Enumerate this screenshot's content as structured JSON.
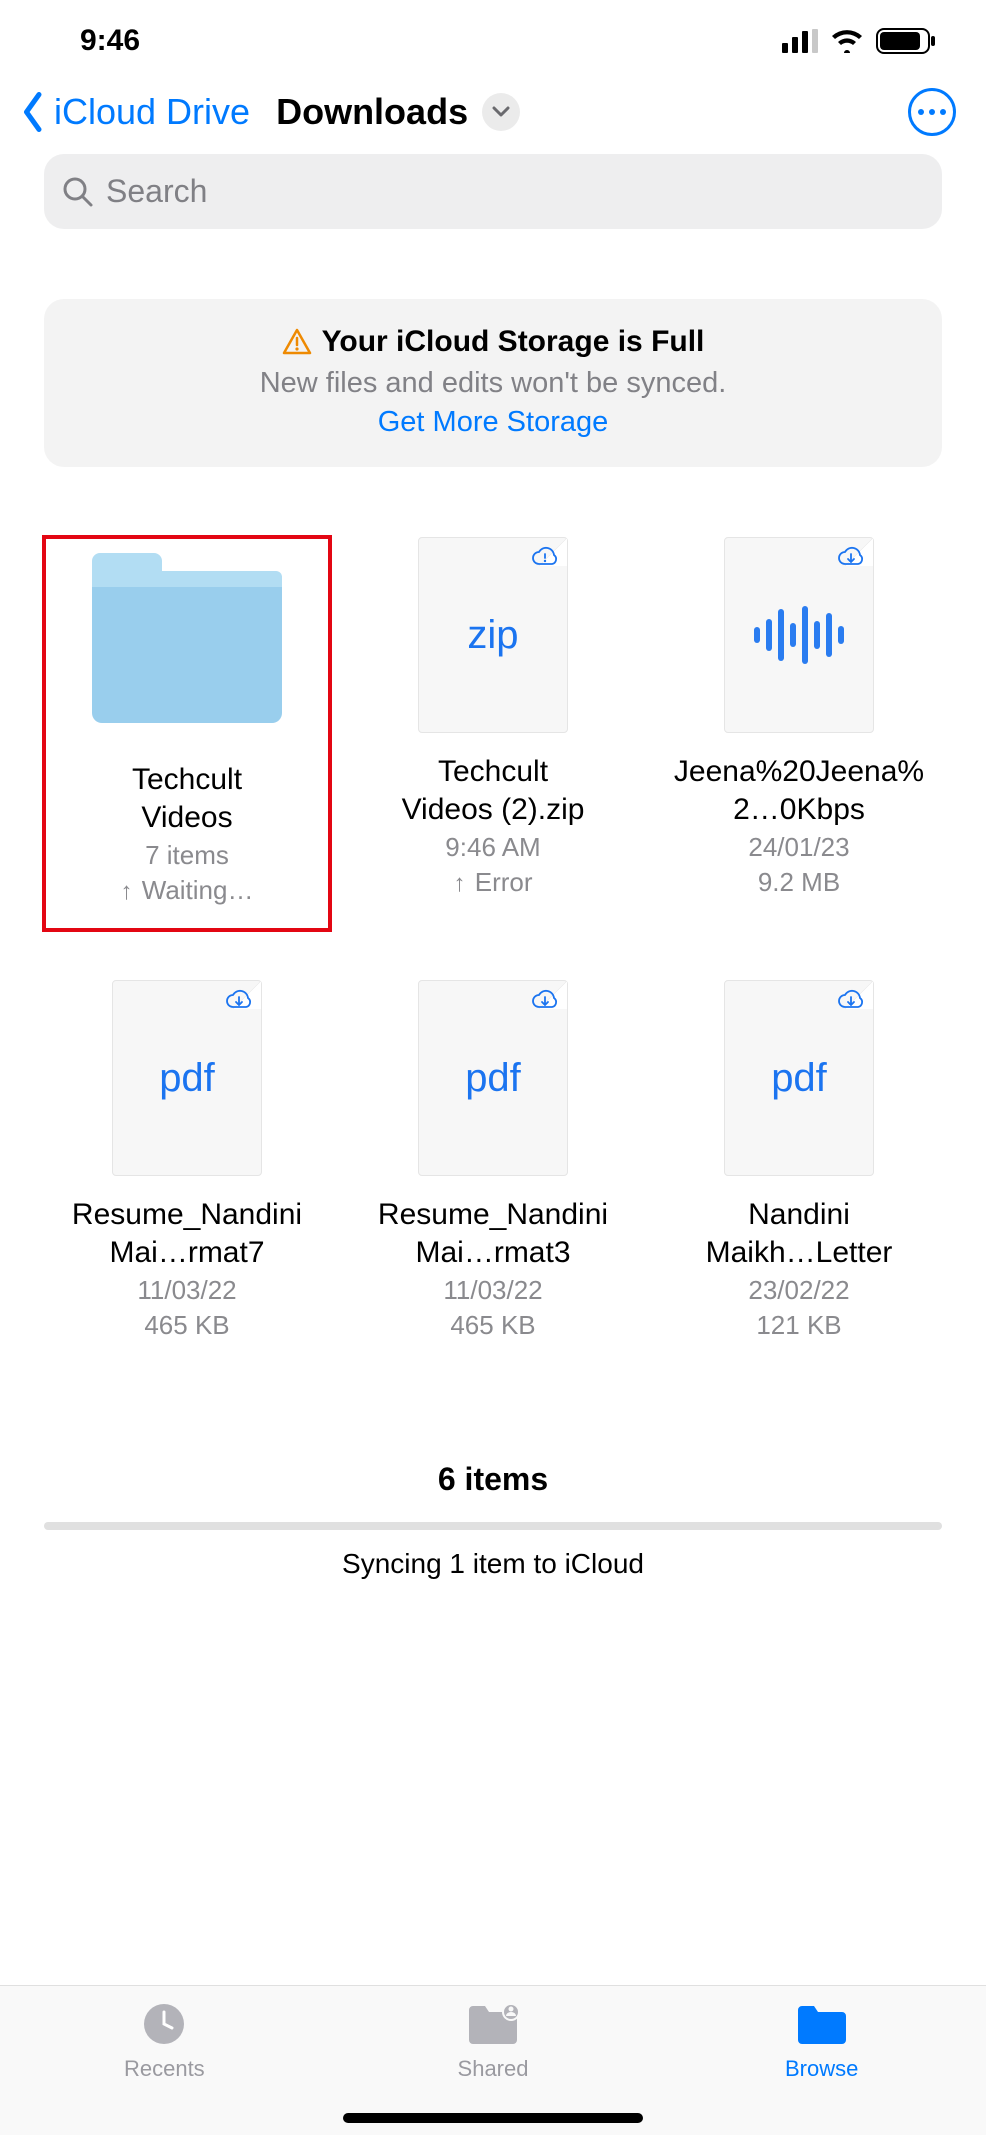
{
  "status": {
    "time": "9:46"
  },
  "nav": {
    "back_label": "iCloud Drive",
    "title": "Downloads"
  },
  "search": {
    "placeholder": "Search"
  },
  "banner": {
    "title": "Your iCloud Storage is Full",
    "subtitle": "New files and edits won't be synced.",
    "link": "Get More Storage"
  },
  "items": [
    {
      "type": "folder",
      "name": "Techcult\nVideos",
      "sub1": "7 items",
      "sub2": "Waiting…",
      "sub2_arrow": true,
      "highlighted": true
    },
    {
      "type": "file",
      "file_type": "zip",
      "cloud": "error",
      "name": "Techcult\nVideos (2).zip",
      "sub1": "9:46 AM",
      "sub2": "Error",
      "sub2_arrow": true
    },
    {
      "type": "file",
      "file_type": "audio",
      "cloud": "download",
      "name": "Jeena%20Jeena%2…0Kbps",
      "sub1": "24/01/23",
      "sub2": "9.2 MB"
    },
    {
      "type": "file",
      "file_type": "pdf",
      "cloud": "download",
      "name": "Resume_Nandini Mai…rmat7",
      "sub1": "11/03/22",
      "sub2": "465 KB"
    },
    {
      "type": "file",
      "file_type": "pdf",
      "cloud": "download",
      "name": "Resume_Nandini Mai…rmat3",
      "sub1": "11/03/22",
      "sub2": "465 KB"
    },
    {
      "type": "file",
      "file_type": "pdf",
      "cloud": "download",
      "name": "Nandini\nMaikh…Letter",
      "sub1": "23/02/22",
      "sub2": "121 KB"
    }
  ],
  "summary": {
    "count": "6 items",
    "sync": "Syncing 1 item to iCloud"
  },
  "tabs": {
    "recents": "Recents",
    "shared": "Shared",
    "browse": "Browse"
  }
}
